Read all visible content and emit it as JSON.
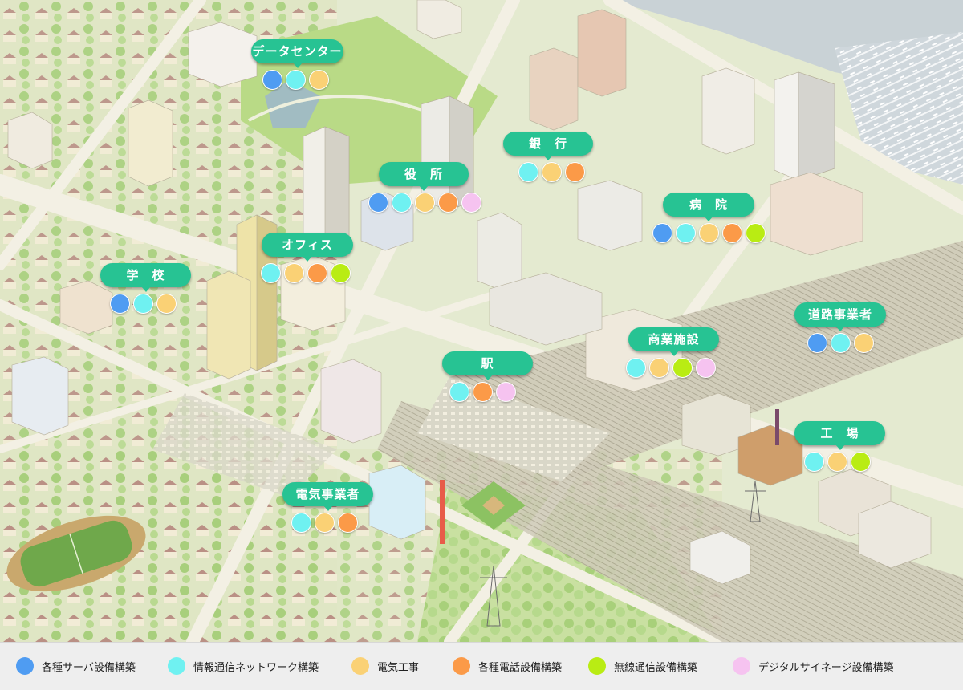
{
  "colors": {
    "server": "#4f9cf2",
    "network": "#6ff1f1",
    "electric": "#fad175",
    "phone": "#fb9a48",
    "wireless": "#b9ec13",
    "signage": "#f6c3f0",
    "label_bg": "#27c393"
  },
  "locations": [
    {
      "name": "データセンター",
      "services": [
        "server",
        "network",
        "electric"
      ]
    },
    {
      "name": "銀　行",
      "services": [
        "network",
        "electric",
        "phone"
      ]
    },
    {
      "name": "役　所",
      "services": [
        "server",
        "network",
        "electric",
        "phone",
        "signage"
      ]
    },
    {
      "name": "病　院",
      "services": [
        "server",
        "network",
        "electric",
        "phone",
        "wireless"
      ]
    },
    {
      "name": "オフィス",
      "services": [
        "network",
        "electric",
        "phone",
        "wireless"
      ]
    },
    {
      "name": "学　校",
      "services": [
        "server",
        "network",
        "electric"
      ]
    },
    {
      "name": "道路事業者",
      "services": [
        "server",
        "network",
        "electric"
      ]
    },
    {
      "name": "商業施設",
      "services": [
        "network",
        "electric",
        "wireless",
        "signage"
      ]
    },
    {
      "name": "駅",
      "services": [
        "network",
        "phone",
        "signage"
      ]
    },
    {
      "name": "工　場",
      "services": [
        "network",
        "electric",
        "wireless"
      ]
    },
    {
      "name": "電気事業者",
      "services": [
        "network",
        "electric",
        "phone"
      ]
    }
  ],
  "legend": [
    {
      "key": "server",
      "label": "各種サーバ設備構築"
    },
    {
      "key": "network",
      "label": "情報通信ネットワーク構築"
    },
    {
      "key": "electric",
      "label": "電気工事"
    },
    {
      "key": "phone",
      "label": "各種電話設備構築"
    },
    {
      "key": "wireless",
      "label": "無線通信設備構築"
    },
    {
      "key": "signage",
      "label": "デジタルサイネージ設備構築"
    }
  ]
}
